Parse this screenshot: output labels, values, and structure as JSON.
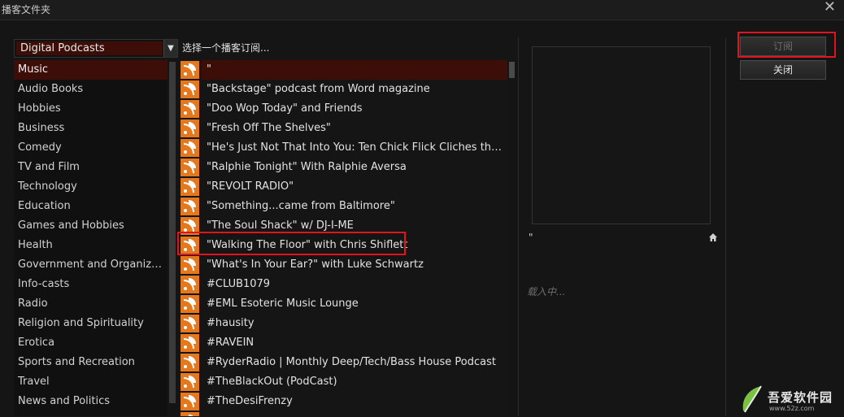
{
  "window": {
    "title": "播客文件夹"
  },
  "categories": {
    "dropdown_value": "Digital Podcasts",
    "items": [
      "Music",
      "Audio Books",
      "Hobbies",
      "Business",
      "Comedy",
      "TV and Film",
      "Technology",
      "Education",
      "Games and Hobbies",
      "Health",
      "Government and Organizati...",
      "Info-casts",
      "Radio",
      "Religion and Spirituality",
      "Erotica",
      "Sports and Recreation",
      "Travel",
      "News and Politics"
    ],
    "selected_index": 0
  },
  "podcasts": {
    "header": "选择一个播客订阅...",
    "items": [
      "\"",
      "\"Backstage\" podcast from Word magazine",
      "\"Doo Wop Today\" and Friends",
      "\"Fresh Off The Shelves\"",
      "\"He's Just Not That Into You: Ten Chick Flick Cliches that are ...",
      "\"Ralphie Tonight\" With Ralphie Aversa",
      "\"REVOLT RADIO\"",
      "\"Something...came from Baltimore\"",
      "\"The Soul Shack\" w/ DJ-I-ME",
      "\"Walking The Floor\" with Chris Shiflett",
      "\"What's In Your Ear?\" with Luke Schwartz",
      "#CLUB1079",
      "#EML Esoteric Music Lounge",
      "#hausity",
      "#RAVEIN",
      "#RyderRadio | Monthly Deep/Tech/Bass House Podcast",
      "#TheBlackOut (PodCast)",
      "#TheDesiFrenzy",
      ""
    ],
    "selected_index": 0
  },
  "preview": {
    "title": "\"",
    "loading_text": "载入中..."
  },
  "buttons": {
    "subscribe": "订阅",
    "close": "关闭"
  },
  "watermark": {
    "text": "吾爱软件园",
    "url": "www.52z.com"
  },
  "colors": {
    "selection": "#3c0e07",
    "highlight_box": "#e0141e",
    "rss": "#e4781f"
  }
}
